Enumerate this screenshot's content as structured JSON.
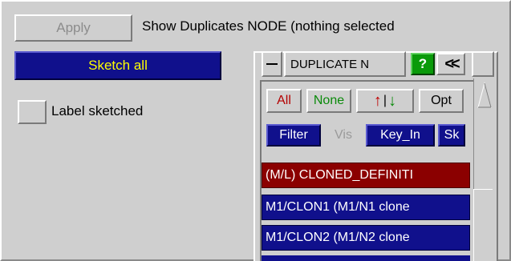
{
  "toolbar": {
    "apply_label": "Apply",
    "info_text": "Show Duplicates NODE (nothing selected"
  },
  "left": {
    "sketch_all_label": "Sketch all",
    "label_sketched_text": "Label sketched",
    "label_sketched_checked": false
  },
  "panel": {
    "title": "DUPLICATE N",
    "help_label": "?",
    "collapse_label": "<<",
    "buttons": {
      "all": "All",
      "none": "None",
      "sort_sep": "|",
      "opt": "Opt",
      "filter": "Filter",
      "vis": "Vis",
      "key_in": "Key_In",
      "sk": "Sk"
    },
    "rows": [
      {
        "label": "(M/L) CLONED_DEFINITI",
        "color": "#8b0000"
      },
      {
        "label": "M1/CLON1 (M1/N1 clone",
        "color": "#10108c"
      },
      {
        "label": "M1/CLON2 (M1/N2 clone",
        "color": "#10108c"
      }
    ]
  },
  "colors": {
    "background": "#cfcfcf",
    "accent_blue": "#10108c",
    "accent_red": "#8b0000",
    "help_green": "#0a9a0a",
    "sketch_text": "#ffff00"
  }
}
